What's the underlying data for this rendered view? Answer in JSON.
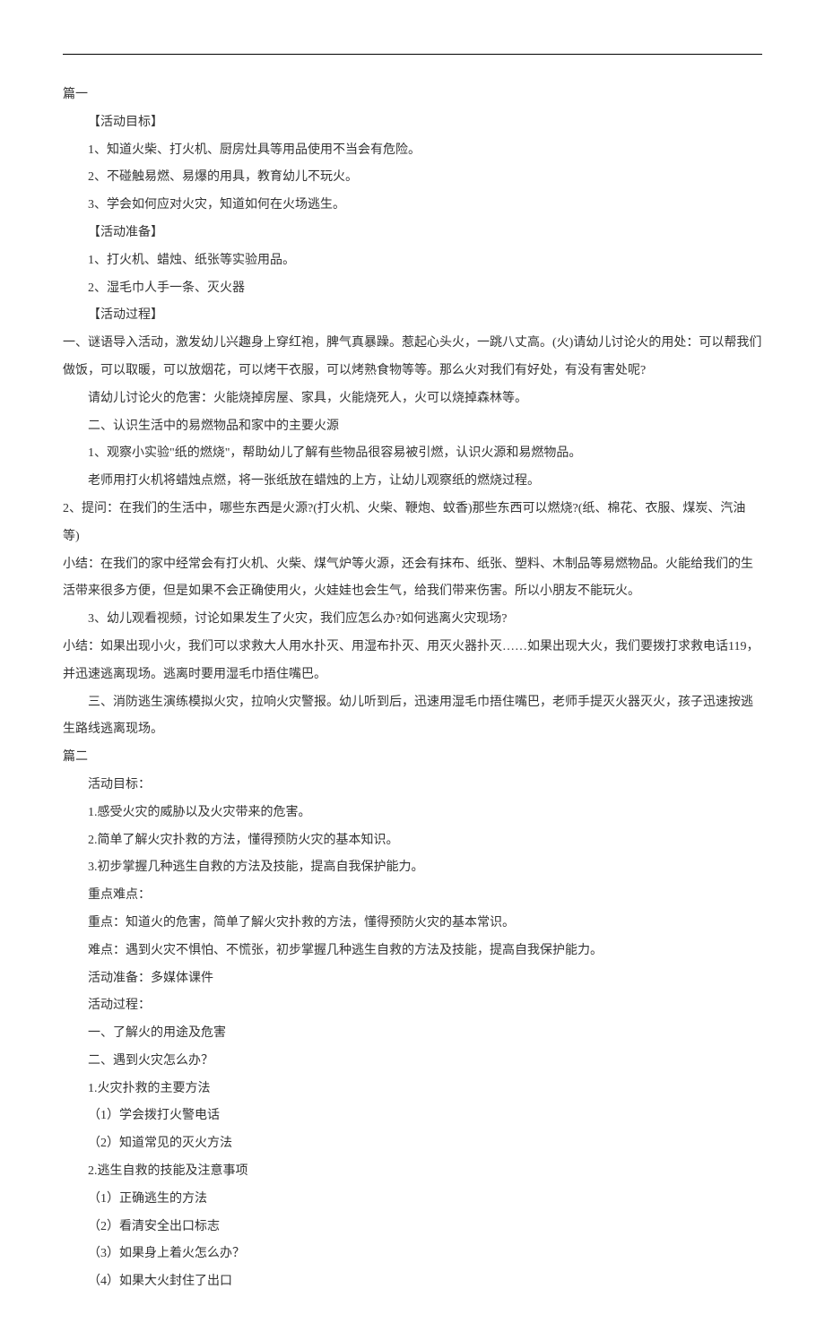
{
  "sections": [
    {
      "title": "篇一",
      "lines": [
        "【活动目标】",
        "1、知道火柴、打火机、厨房灶具等用品使用不当会有危险。",
        "2、不碰触易燃、易爆的用具，教育幼儿不玩火。",
        "3、学会如何应对火灾，知道如何在火场逃生。",
        "【活动准备】",
        "1、打火机、蜡烛、纸张等实验用品。",
        "2、湿毛巾人手一条、灭火器",
        "【活动过程】",
        "一、谜语导入活动，激发幼儿兴趣身上穿红袍，脾气真暴躁。惹起心头火，一跳八丈高。(火)请幼儿讨论火的用处：可以帮我们做饭，可以取暖，可以放烟花，可以烤干衣服，可以烤熟食物等等。那么火对我们有好处，有没有害处呢?",
        "请幼儿讨论火的危害：火能烧掉房屋、家具，火能烧死人，火可以烧掉森林等。",
        "二、认识生活中的易燃物品和家中的主要火源",
        "1、观察小实验\"纸的燃烧\"，帮助幼儿了解有些物品很容易被引燃，认识火源和易燃物品。",
        "老师用打火机将蜡烛点燃，将一张纸放在蜡烛的上方，让幼儿观察纸的燃烧过程。",
        "2、提问：在我们的生活中，哪些东西是火源?(打火机、火柴、鞭炮、蚊香)那些东西可以燃烧?(纸、棉花、衣服、煤炭、汽油等)",
        "小结：在我们的家中经常会有打火机、火柴、煤气炉等火源，还会有抹布、纸张、塑料、木制品等易燃物品。火能给我们的生活带来很多方便，但是如果不会正确使用火，火娃娃也会生气，给我们带来伤害。所以小朋友不能玩火。",
        "3、幼儿观看视频，讨论如果发生了火灾，我们应怎么办?如何逃离火灾现场?",
        "小结：如果出现小火，我们可以求救大人用水扑灭、用湿布扑灭、用灭火器扑灭……如果出现大火，我们要拨打求救电话119，并迅速逃离现场。逃离时要用湿毛巾捂住嘴巴。",
        "三、消防逃生演练模拟火灾，拉响火灾警报。幼儿听到后，迅速用湿毛巾捂住嘴巴，老师手提灭火器灭火，孩子迅速按逃生路线逃离现场。"
      ],
      "wrapIndices": [
        8,
        13,
        14,
        16
      ]
    },
    {
      "title": "篇二",
      "lines": [
        "活动目标：",
        "1.感受火灾的威胁以及火灾带来的危害。",
        "2.简单了解火灾扑救的方法，懂得预防火灾的基本知识。",
        "3.初步掌握几种逃生自救的方法及技能，提高自我保护能力。",
        "重点难点：",
        "重点：知道火的危害，简单了解火灾扑救的方法，懂得预防火灾的基本常识。",
        "难点：遇到火灾不惧怕、不慌张，初步掌握几种逃生自救的方法及技能，提高自我保护能力。",
        "活动准备：多媒体课件",
        "活动过程：",
        "一、了解火的用途及危害",
        "二、遇到火灾怎么办？",
        "1.火灾扑救的主要方法",
        "（1）学会拨打火警电话",
        "（2）知道常见的灭火方法",
        "2.逃生自救的技能及注意事项",
        "（1）正确逃生的方法",
        "（2）看清安全出口标志",
        "（3）如果身上着火怎么办？",
        "（4）如果大火封住了出口"
      ],
      "wrapIndices": []
    }
  ]
}
